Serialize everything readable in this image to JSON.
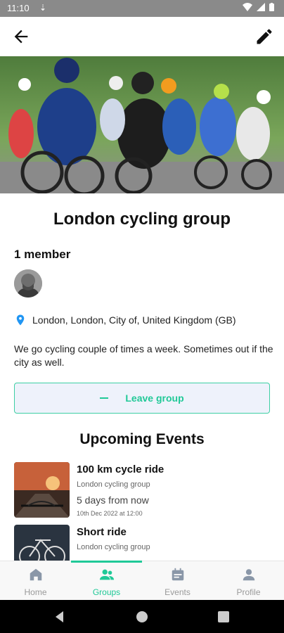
{
  "status_bar": {
    "time": "11:10"
  },
  "group": {
    "title": "London cycling group",
    "members_label": "1 member",
    "location": "London, London, City of, United Kingdom (GB)",
    "description": "We go cycling couple of times a week. Sometimes out if the city as well.",
    "leave_label": "Leave group"
  },
  "events": {
    "heading": "Upcoming Events",
    "items": [
      {
        "name": "100 km cycle ride",
        "group": "London cycling group",
        "when": "5 days from now",
        "date": "10th Dec 2022 at 12:00"
      },
      {
        "name": "Short ride",
        "group": "London cycling group"
      }
    ]
  },
  "nav": {
    "items": [
      {
        "label": "Home",
        "icon": "home-icon"
      },
      {
        "label": "Groups",
        "icon": "groups-icon"
      },
      {
        "label": "Events",
        "icon": "calendar-icon"
      },
      {
        "label": "Profile",
        "icon": "person-icon"
      }
    ],
    "active_index": 1
  },
  "colors": {
    "accent": "#20c997",
    "status_bar": "#8a8a8a",
    "location_pin": "#2196f3"
  }
}
